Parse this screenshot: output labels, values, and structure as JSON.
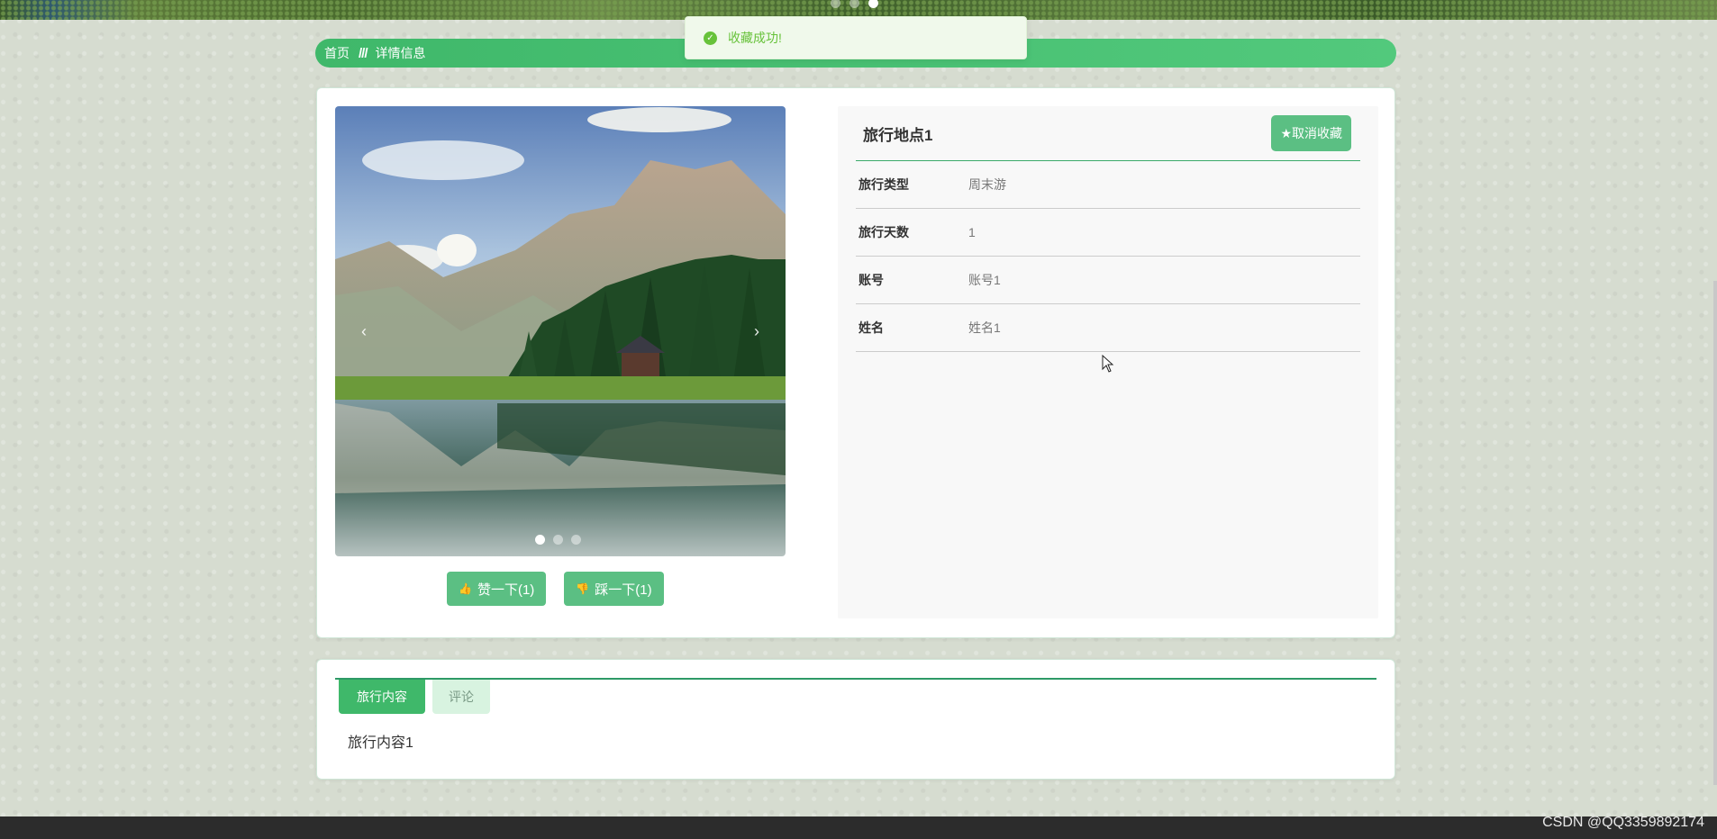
{
  "banner": {
    "slide_count": 3,
    "active_index": 2
  },
  "breadcrumb": {
    "home": "首页",
    "separator": "///",
    "current": "详情信息"
  },
  "toast": {
    "message": "收藏成功!",
    "icon": "check-circle-icon"
  },
  "detail": {
    "title": "旅行地点1",
    "collect_label": "★取消收藏",
    "fields": [
      {
        "key": "旅行类型",
        "value": "周末游"
      },
      {
        "key": "旅行天数",
        "value": "1"
      },
      {
        "key": "账号",
        "value": "账号1"
      },
      {
        "key": "姓名",
        "value": "姓名1"
      }
    ],
    "carousel": {
      "slide_count": 3,
      "active_index": 0,
      "prev": "‹",
      "next": "›"
    },
    "vote": {
      "like_label": "赞一下(1)",
      "dislike_label": "踩一下(1)"
    }
  },
  "content": {
    "tabs": [
      {
        "label": "旅行内容",
        "active": true
      },
      {
        "label": "评论",
        "active": false
      }
    ],
    "text": "旅行内容1"
  },
  "watermark": "CSDN @QQ3359892174",
  "colors": {
    "primary": "#3fb86a",
    "button": "#5bbf83",
    "success": "#67c23a"
  }
}
